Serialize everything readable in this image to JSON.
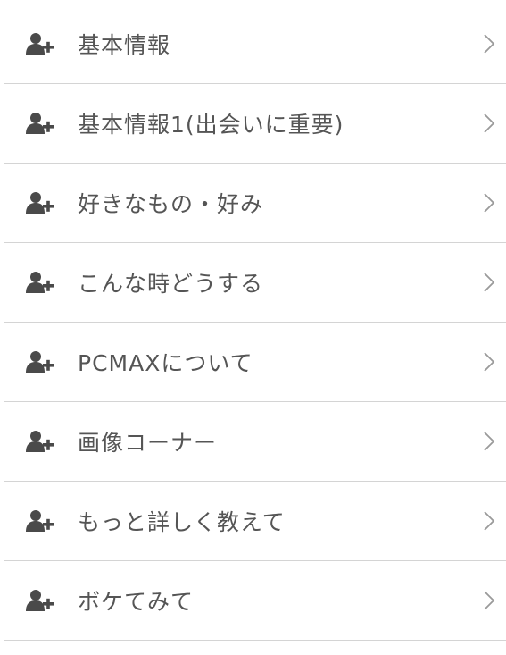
{
  "menu": {
    "items": [
      {
        "label": "基本情報",
        "icon": "user-plus-icon",
        "chevron": "chevron-right-icon"
      },
      {
        "label": "基本情報1(出会いに重要)",
        "icon": "user-plus-icon",
        "chevron": "chevron-right-icon"
      },
      {
        "label": "好きなもの・好み",
        "icon": "user-plus-icon",
        "chevron": "chevron-right-icon"
      },
      {
        "label": "こんな時どうする",
        "icon": "user-plus-icon",
        "chevron": "chevron-right-icon"
      },
      {
        "label": "PCMAXについて",
        "icon": "user-plus-icon",
        "chevron": "chevron-right-icon"
      },
      {
        "label": "画像コーナー",
        "icon": "user-plus-icon",
        "chevron": "chevron-right-icon"
      },
      {
        "label": "もっと詳しく教えて",
        "icon": "user-plus-icon",
        "chevron": "chevron-right-icon"
      },
      {
        "label": "ボケてみて",
        "icon": "user-plus-icon",
        "chevron": "chevron-right-icon"
      }
    ]
  },
  "colors": {
    "text": "#555555",
    "icon": "#4a4a4a",
    "divider": "#d4d4d4",
    "chevron": "#9a9a9a",
    "background": "#ffffff"
  }
}
